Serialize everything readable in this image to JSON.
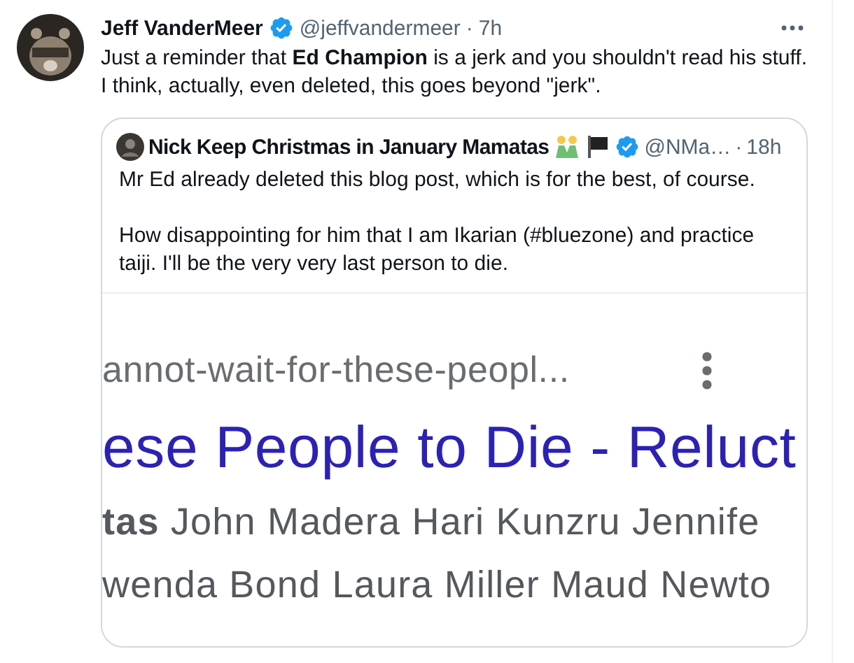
{
  "tweet": {
    "author": "Jeff VanderMeer",
    "verified": true,
    "handle": "@jeffvandermeer",
    "separator": "·",
    "time": "7h",
    "text": "Just a reminder that **Ed Champion** is a jerk and you shouldn't read his stuff. I think, actually, even deleted, this goes beyond \"jerk\".",
    "quote": {
      "author": "Nick Keep Christmas in January Mamatas",
      "verified": true,
      "handle": "@NMa…",
      "separator": "·",
      "time": "18h",
      "paragraphs": [
        "Mr Ed already deleted this blog post, which is for the best, of course.",
        "How disappointing for him that I am Ikarian (#bluezone) and practice taiji. I'll be the very very last person to die."
      ],
      "image": {
        "url": "annot-wait-for-these-peopl...",
        "title": "ese People to Die - Reluct",
        "snippet_lines": [
          "**tas** John Madera Hari Kunzru Jennife",
          "wenda Bond Laura Miller Maud Newto"
        ]
      }
    }
  }
}
